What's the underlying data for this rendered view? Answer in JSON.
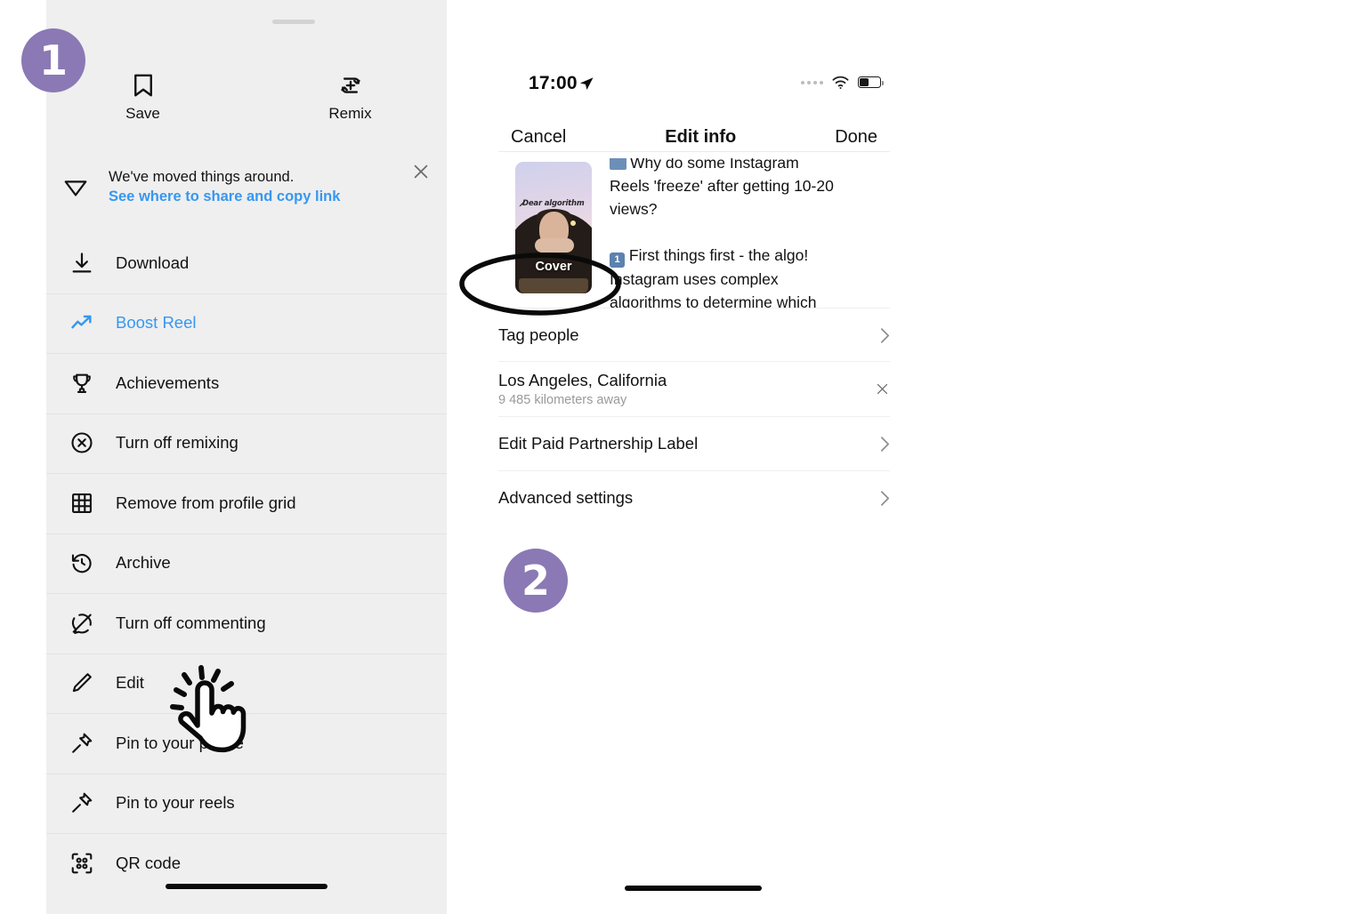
{
  "annotations": {
    "step1": "1",
    "step2": "2",
    "badge_color": "#8a79b4",
    "ellipse_target": "Cover",
    "cursor": "tap-hand-cursor"
  },
  "left_panel": {
    "drag_handle": "drag-handle",
    "quick_actions": [
      {
        "label": "Save",
        "icon": "bookmark-icon"
      },
      {
        "label": "Remix",
        "icon": "remix-icon"
      }
    ],
    "banner": {
      "icon": "paper-plane-icon",
      "title": "We've moved things around.",
      "link": "See where to share and copy link",
      "close_icon": "close-icon",
      "link_color": "#3797f0"
    },
    "menu_items": [
      {
        "label": "Download",
        "icon": "download-icon",
        "accent": false
      },
      {
        "label": "Boost Reel",
        "icon": "trending-up-icon",
        "accent": true
      },
      {
        "label": "Achievements",
        "icon": "trophy-icon",
        "accent": false
      },
      {
        "label": "Turn off remixing",
        "icon": "circle-x-icon",
        "accent": false
      },
      {
        "label": "Remove from profile grid",
        "icon": "grid-icon",
        "accent": false
      },
      {
        "label": "Archive",
        "icon": "clock-rewind-icon",
        "accent": false
      },
      {
        "label": "Turn off commenting",
        "icon": "comment-off-icon",
        "accent": false
      },
      {
        "label": "Edit",
        "icon": "pencil-icon",
        "accent": false
      },
      {
        "label": "Pin to your profile",
        "icon": "pin-icon",
        "accent": false
      },
      {
        "label": "Pin to your reels",
        "icon": "pin-icon",
        "accent": false
      },
      {
        "label": "QR code",
        "icon": "qr-code-icon",
        "accent": false
      }
    ]
  },
  "right_panel": {
    "status_bar": {
      "time": "17:00",
      "location_icon": "location-arrow-icon",
      "signal_icon": "signal-dots-icon",
      "wifi_icon": "wifi-icon",
      "battery_icon": "battery-icon"
    },
    "nav": {
      "cancel": "Cancel",
      "title": "Edit info",
      "done": "Done"
    },
    "cover": {
      "label": "Cover",
      "overlay_text": "Dear algorithm"
    },
    "caption": {
      "line_clipped": "Why do some Instagram",
      "line2": "Reels 'freeze' after getting 10-20",
      "line3": "views?",
      "para2_badge": "1",
      "para2_line1": "First things first - the algo!",
      "para2_line2": "Instagram uses complex",
      "para2_line3": "algorithms to determine which"
    },
    "rows": [
      {
        "title": "Tag people",
        "sub": "",
        "trailing": "chevron-right-icon"
      },
      {
        "title": "Los Angeles, California",
        "sub": "9 485 kilometers away",
        "trailing": "close-icon"
      },
      {
        "title": "Edit Paid Partnership Label",
        "sub": "",
        "trailing": "chevron-right-icon"
      },
      {
        "title": "Advanced settings",
        "sub": "",
        "trailing": "chevron-right-icon"
      }
    ]
  }
}
